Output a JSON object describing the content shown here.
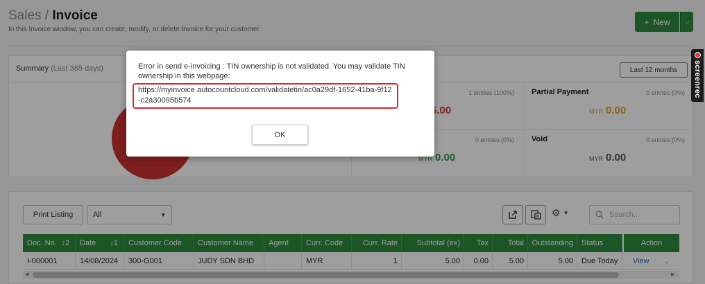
{
  "header": {
    "breadcrumb_parent": "Sales",
    "breadcrumb_sep": " / ",
    "title": "Invoice",
    "subtitle": "In this Invoice window, you can create, modify, or delete Invoice for your customer.",
    "new_label": "New",
    "new_icon": "plus-icon"
  },
  "summary": {
    "title": "Summary",
    "period_note": "(Last 365 days)",
    "period_button": "Last 12 months",
    "chart_color": "#cc3333",
    "stats": [
      {
        "label": "",
        "entries": "1 entries (100%)",
        "currency": "",
        "amount": "5.00",
        "color": "#d23b3b"
      },
      {
        "label": "Partial Payment",
        "entries": "0 entries (0%)",
        "currency": "MYR",
        "amount": "0.00",
        "color": "#e0a12a"
      },
      {
        "label": "",
        "entries": "0 entries (0%)",
        "currency": "MYR",
        "amount": "0.00",
        "color": "#2e9a43"
      },
      {
        "label": "Void",
        "entries": "0 entries (0%)",
        "currency": "MYR",
        "amount": "0.00",
        "color": "#555555"
      }
    ]
  },
  "toolbar": {
    "print_label": "Print Listing",
    "filter_value": "All",
    "search_placeholder": "Search..."
  },
  "grid": {
    "header_color": "#2e8b3e",
    "columns": [
      "Doc. No.",
      "Date",
      "Customer Code",
      "Customer Name",
      "Agent",
      "Curr. Code",
      "Curr. Rate",
      "Subtotal (ex)",
      "Tax",
      "Total",
      "Outstanding",
      "Status",
      "Action"
    ],
    "sort_docno": "↓2",
    "sort_date": "↓1",
    "rows": [
      {
        "doc_no": "I-000001",
        "date": "14/08/2024",
        "customer_code": "300-G001",
        "customer_name": "JUDY SDN BHD",
        "agent": "",
        "curr_code": "MYR",
        "curr_rate": "1",
        "subtotal": "5.00",
        "tax": "0.00",
        "total": "5.00",
        "outstanding": "5.00",
        "status": "Due Today",
        "action": "View"
      }
    ]
  },
  "dialog": {
    "message": "Error in send e-invoicing : TIN ownership is not validated. You may validate TIN ownership in this webpage:",
    "link": "https://myinvoice.autocountcloud.com/validatetin/ac0a29df-1652-41ba-9f12-c2a30095b574",
    "ok_label": "OK"
  },
  "screenrec": {
    "label": "screenrec"
  }
}
